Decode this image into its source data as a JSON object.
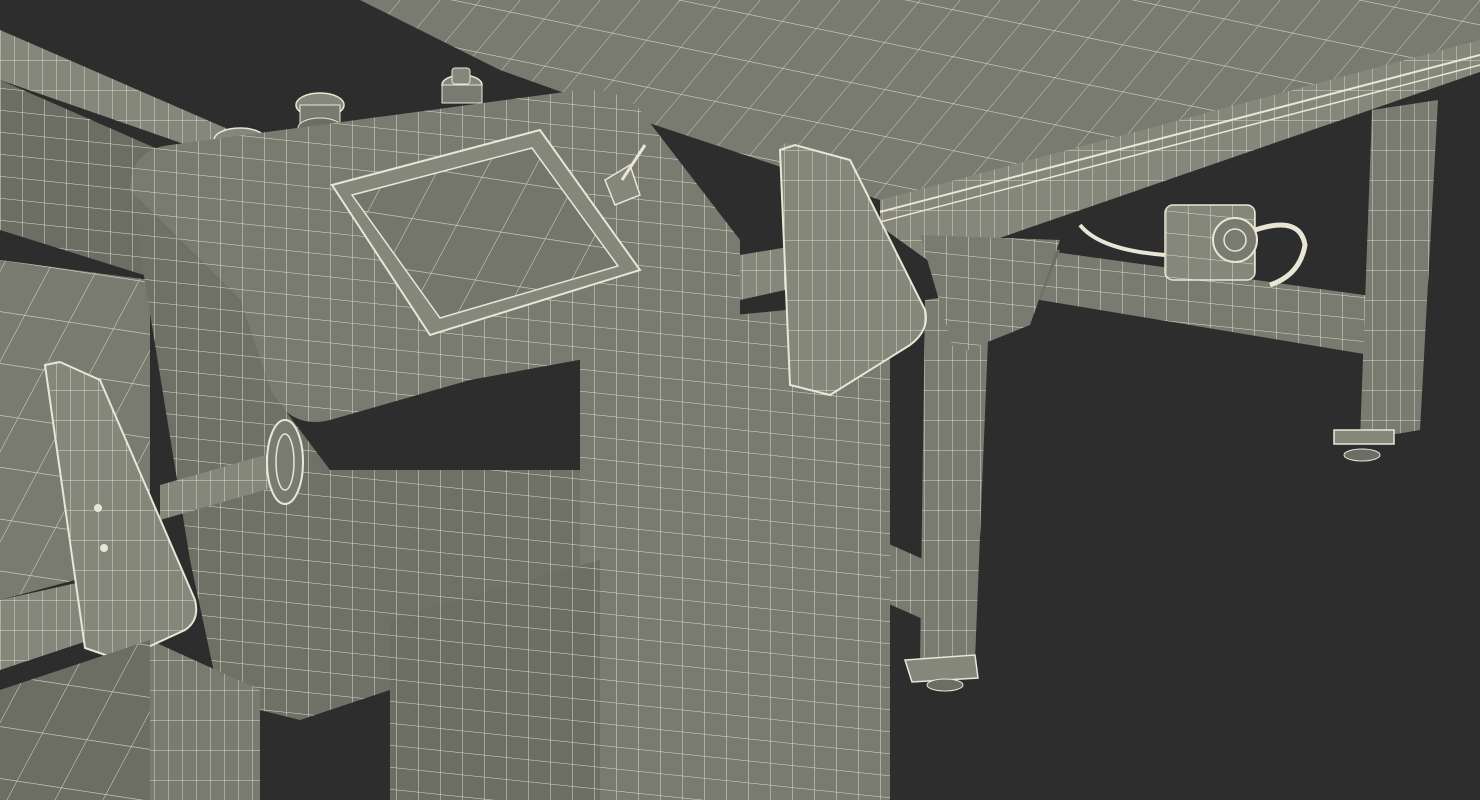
{
  "scene": {
    "subject": "wireframe-cutting-machine-table",
    "colors": {
      "background": "#2d2d2d",
      "surface": "#7a7b70",
      "surface_light": "#86877b",
      "surface_dark": "#5f6057",
      "wire": "#e9e6d6"
    }
  }
}
